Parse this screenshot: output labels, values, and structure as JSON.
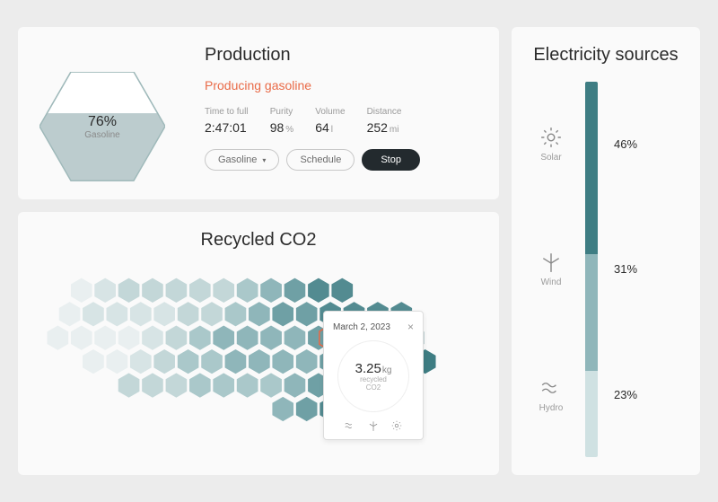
{
  "production": {
    "title": "Production",
    "status": "Producing gasoline",
    "gauge": {
      "percent_label": "76%",
      "sub_label": "Gasoline",
      "fill_ratio": 0.62
    },
    "metrics": {
      "time_to_full": {
        "label": "Time to full",
        "value": "2:47:01",
        "unit": ""
      },
      "purity": {
        "label": "Purity",
        "value": "98",
        "unit": "%"
      },
      "volume": {
        "label": "Volume",
        "value": "64",
        "unit": "l"
      },
      "distance": {
        "label": "Distance",
        "value": "252",
        "unit": "mi"
      }
    },
    "buttons": {
      "gasoline": "Gasoline",
      "schedule": "Schedule",
      "stop": "Stop"
    }
  },
  "recycled": {
    "title": "Recycled CO2",
    "tooltip": {
      "date": "March 2, 2023",
      "value": "3.25",
      "unit": "kg",
      "sub1": "recycled",
      "sub2": "CO2"
    }
  },
  "sources": {
    "title": "Electricity sources",
    "items": [
      {
        "name": "Solar",
        "percent_label": "46%",
        "percent": 46,
        "color": "#3e7d83"
      },
      {
        "name": "Wind",
        "percent_label": "31%",
        "percent": 31,
        "color": "#8fb6ba"
      },
      {
        "name": "Hydro",
        "percent_label": "23%",
        "percent": 23,
        "color": "#cfe1e2"
      }
    ]
  },
  "colors": {
    "accent": "#e96a47",
    "dark": "#232a2e"
  }
}
